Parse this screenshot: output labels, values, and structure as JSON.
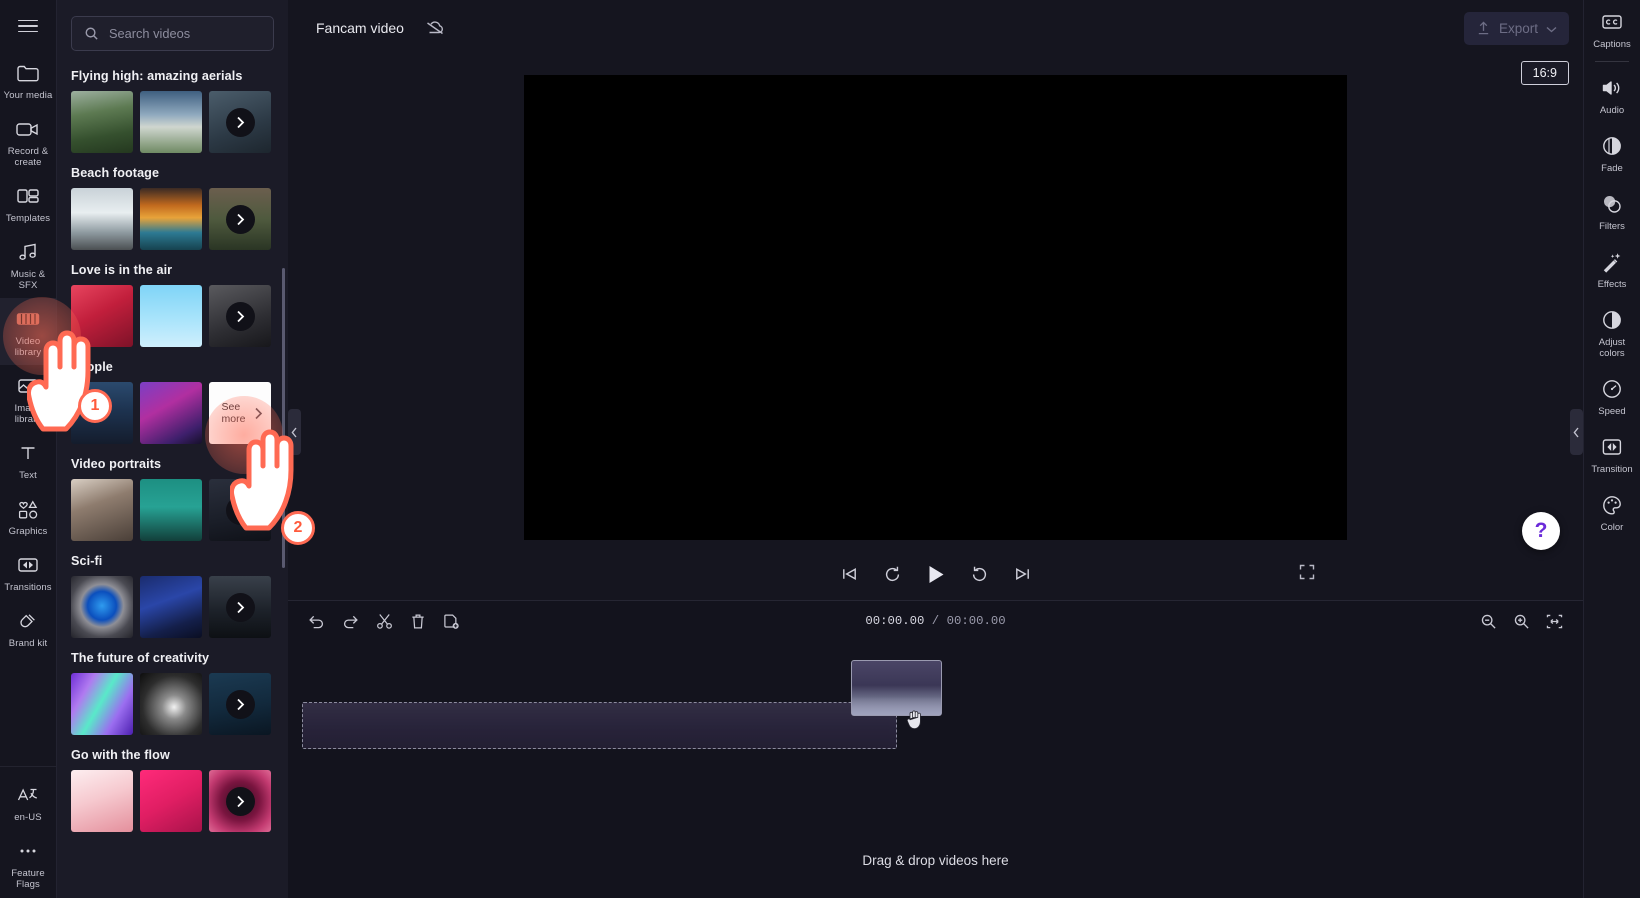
{
  "app": {
    "title_bar": {
      "project_title": "Fancam video",
      "cloud_status_icon": "cloud-off-icon",
      "export_label": "Export",
      "export_icon": "upload-icon",
      "export_chevron": "chevron-down-icon"
    }
  },
  "left_rail": {
    "menu_icon": "hamburger-menu-icon",
    "items": [
      {
        "label": "Your media",
        "icon": "folder-icon",
        "active": false
      },
      {
        "label": "Record & create",
        "icon": "video-camera-icon",
        "active": false
      },
      {
        "label": "Templates",
        "icon": "templates-icon",
        "active": false
      },
      {
        "label": "Music & SFX",
        "icon": "music-note-icon",
        "active": false
      },
      {
        "label": "Video library",
        "icon": "film-strip-icon",
        "active": true
      },
      {
        "label": "Image library",
        "icon": "image-icon",
        "active": false
      },
      {
        "label": "Text",
        "icon": "text-t-icon",
        "active": false
      },
      {
        "label": "Graphics",
        "icon": "shapes-icon",
        "active": false
      },
      {
        "label": "Transitions",
        "icon": "transition-icon",
        "active": false
      },
      {
        "label": "Brand kit",
        "icon": "brand-kit-icon",
        "active": false
      }
    ],
    "bottom_items": [
      {
        "label": "en-US",
        "icon": "language-icon"
      },
      {
        "label": "Feature Flags",
        "icon": "ellipsis-icon"
      }
    ]
  },
  "library": {
    "search": {
      "placeholder": "Search videos",
      "value": "",
      "icon": "search-icon"
    },
    "see_more_label_line1": "See",
    "see_more_label_line2": "more",
    "categories": [
      {
        "title": "Flying high: amazing aerials",
        "thumbs": [
          "a1",
          "a2",
          "a3"
        ],
        "more": "chevron-right-icon"
      },
      {
        "title": "Beach footage",
        "thumbs": [
          "b1",
          "b2",
          "b3"
        ],
        "more": "chevron-right-icon"
      },
      {
        "title": "Love is in the air",
        "thumbs": [
          "c1",
          "c2",
          "c3"
        ],
        "more": "chevron-right-icon"
      },
      {
        "title": "People",
        "thumbs": [
          "d1",
          "d2"
        ],
        "more": "see-more-card"
      },
      {
        "title": "Video portraits",
        "thumbs": [
          "e1",
          "e2",
          "e3"
        ],
        "more": "chevron-right-icon"
      },
      {
        "title": "Sci-fi",
        "thumbs": [
          "f1",
          "f2",
          "f3"
        ],
        "more": "chevron-right-icon"
      },
      {
        "title": "The future of creativity",
        "thumbs": [
          "g1",
          "g2",
          "g3"
        ],
        "more": "chevron-right-icon"
      },
      {
        "title": "Go with the flow",
        "thumbs": [
          "h1",
          "h2",
          "h3"
        ],
        "more": "chevron-right-icon"
      }
    ]
  },
  "preview": {
    "aspect_ratio": "16:9",
    "controls": [
      {
        "name": "skip-to-start-button",
        "icon": "skip-back-icon"
      },
      {
        "name": "rewind-button",
        "icon": "rewind-arrow-icon"
      },
      {
        "name": "play-button",
        "icon": "play-triangle-icon"
      },
      {
        "name": "forward-button",
        "icon": "forward-arrow-icon"
      },
      {
        "name": "skip-to-end-button",
        "icon": "skip-forward-icon"
      }
    ],
    "fullscreen_icon": "fullscreen-icon",
    "help_label": "?"
  },
  "timeline": {
    "tools": [
      {
        "name": "undo-button",
        "icon": "undo-arrow-icon"
      },
      {
        "name": "redo-button",
        "icon": "redo-arrow-icon"
      },
      {
        "name": "split-button",
        "icon": "scissors-icon"
      },
      {
        "name": "delete-button",
        "icon": "trash-icon"
      },
      {
        "name": "duplicate-button",
        "icon": "duplicate-icon"
      }
    ],
    "current_time": "00:00.00",
    "time_separator": " / ",
    "total_time": "00:00.00",
    "zoom_controls": [
      {
        "name": "zoom-out-button",
        "icon": "magnifier-minus-icon"
      },
      {
        "name": "zoom-in-button",
        "icon": "magnifier-plus-icon"
      },
      {
        "name": "fit-to-screen-button",
        "icon": "fit-arrows-icon"
      }
    ],
    "drop_hint": "Drag & drop videos here"
  },
  "right_rail": {
    "items": [
      {
        "label": "Captions",
        "icon": "closed-caption-icon",
        "divider_after": true
      },
      {
        "label": "Audio",
        "icon": "speaker-icon",
        "divider_after": false
      },
      {
        "label": "Fade",
        "icon": "fade-circle-icon",
        "divider_after": false
      },
      {
        "label": "Filters",
        "icon": "filters-circles-icon",
        "divider_after": false
      },
      {
        "label": "Effects",
        "icon": "magic-wand-icon",
        "divider_after": false
      },
      {
        "label": "Adjust colors",
        "icon": "half-circle-icon",
        "divider_after": false
      },
      {
        "label": "Speed",
        "icon": "speedometer-icon",
        "divider_after": false
      },
      {
        "label": "Transition",
        "icon": "transition-icon",
        "divider_after": false
      },
      {
        "label": "Color",
        "icon": "palette-icon",
        "divider_after": false
      }
    ]
  },
  "tutorial": {
    "steps": [
      {
        "number": "1",
        "target": "video-library-rail-item"
      },
      {
        "number": "2",
        "target": "see-more-card"
      }
    ],
    "accent_color": "#ff6a53"
  },
  "collapse": {
    "left_handle_icon": "chevron-left-icon",
    "right_handle_icon": "chevron-left-icon"
  }
}
